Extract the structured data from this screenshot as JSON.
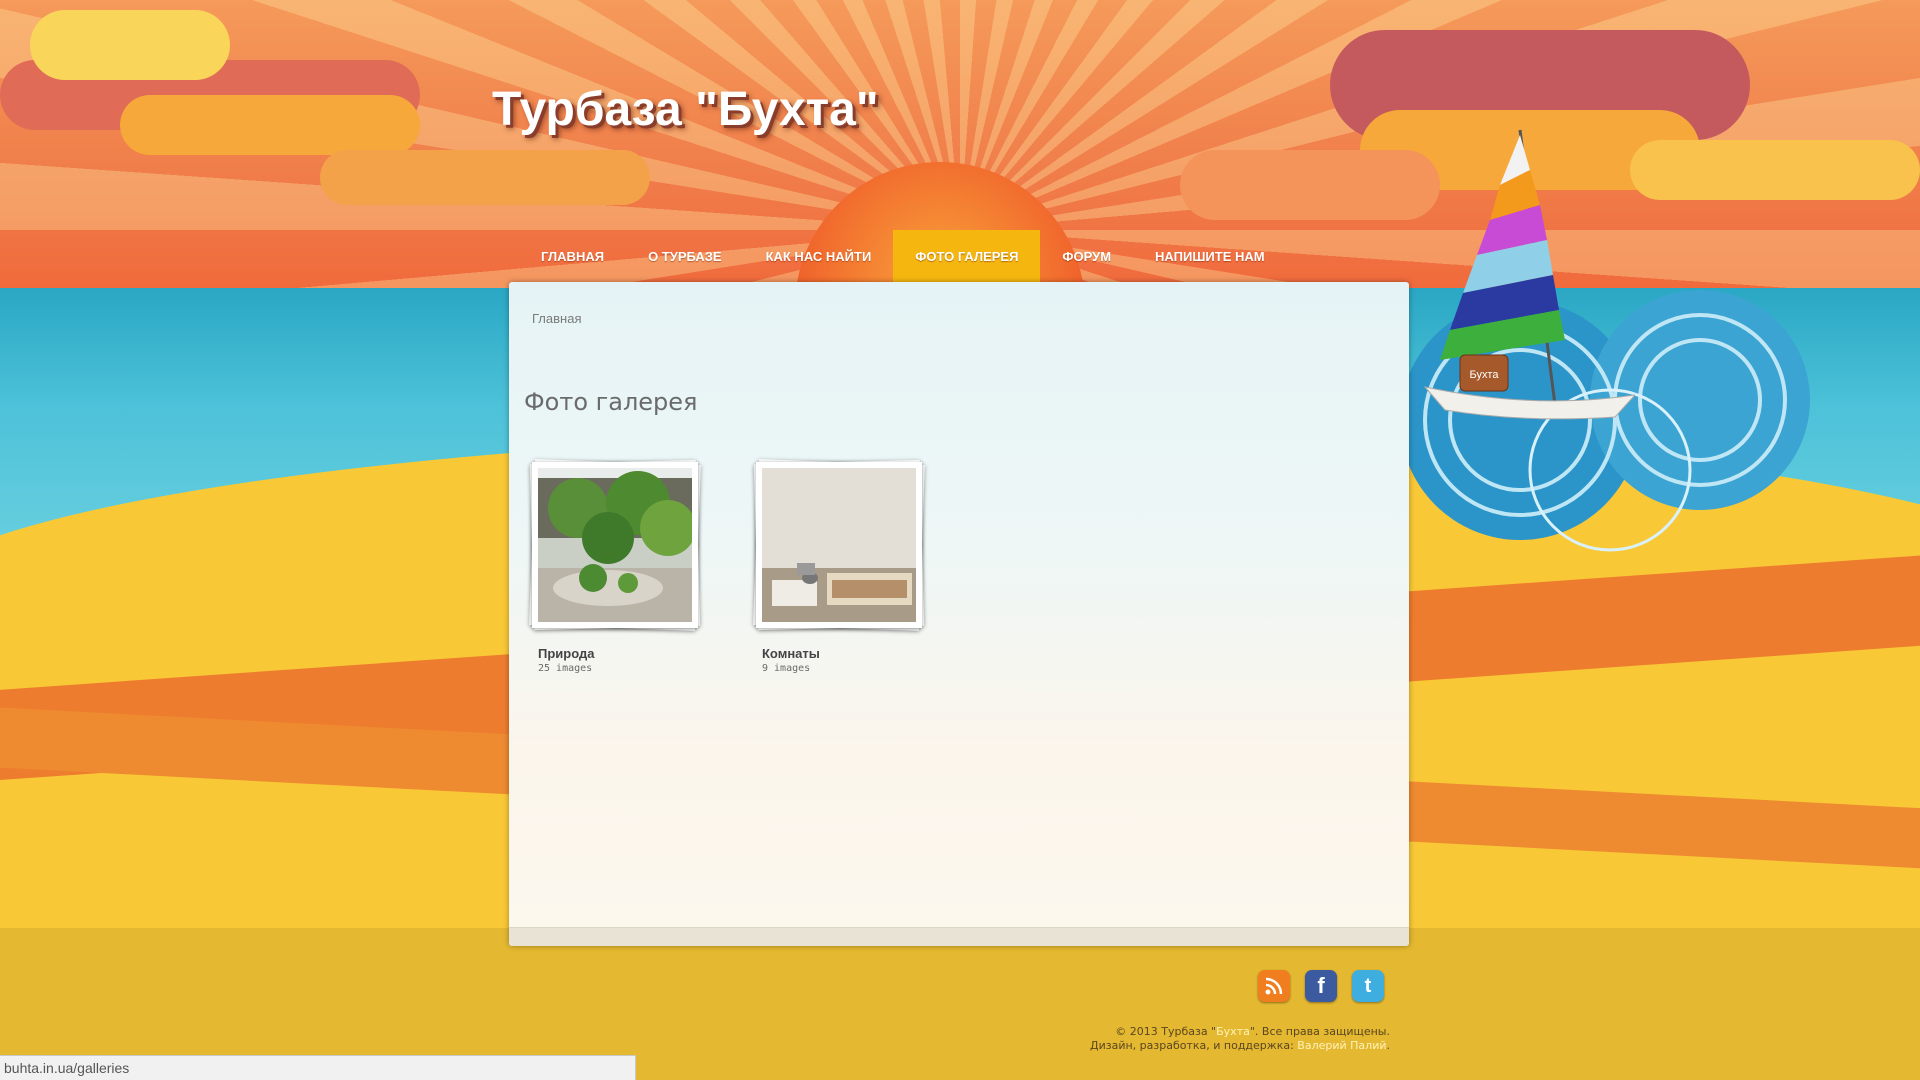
{
  "site": {
    "title": "Турбаза \"Бухта\""
  },
  "nav": [
    {
      "label": "ГЛАВНАЯ",
      "active": false
    },
    {
      "label": "О ТУРБАЗЕ",
      "active": false
    },
    {
      "label": "КАК НАС НАЙТИ",
      "active": false
    },
    {
      "label": "ФОТО ГАЛЕРЕЯ",
      "active": true
    },
    {
      "label": "ФОРУМ",
      "active": false
    },
    {
      "label": "НАПИШИТЕ НАМ",
      "active": false
    }
  ],
  "breadcrumb": "Главная",
  "page": {
    "heading": "Фото галерея"
  },
  "albums": [
    {
      "title": "Природа",
      "count": "25 images"
    },
    {
      "title": "Комнаты",
      "count": "9 images"
    }
  ],
  "boat_sign": "Бухта",
  "social": [
    {
      "name": "rss-icon",
      "color": "#f07d1e"
    },
    {
      "name": "facebook-icon",
      "color": "#3b5aa0"
    },
    {
      "name": "twitter-icon",
      "color": "#3eaee0"
    }
  ],
  "footer": {
    "line1_prefix": "© 2013 Турбаза \"",
    "line1_link": "Бухта",
    "line1_suffix": "\". Все права защищены.",
    "line2_prefix": "Дизайн, разработка, и поддержка: ",
    "line2_link": "Валерий Палий",
    "line2_suffix": "."
  },
  "status_url": "buhta.in.ua/galleries",
  "colors": {
    "nav_active": "#f5b70f",
    "sand": "#f9c836",
    "sea": "#2aa7c4",
    "sky": "#f07d4a"
  }
}
